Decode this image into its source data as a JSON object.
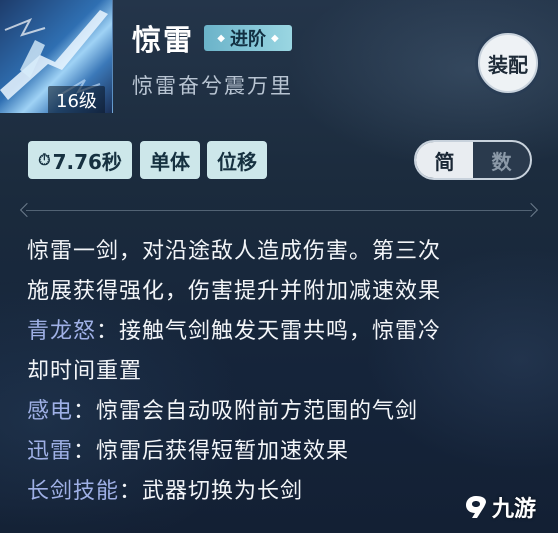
{
  "skill": {
    "name": "惊雷",
    "advance_label": "进阶",
    "subtitle": "惊雷奋兮震万里",
    "level": "16级",
    "equip_label": "装配"
  },
  "tags": {
    "cooldown": "7.76秒",
    "target": "单体",
    "movement": "位移"
  },
  "toggle": {
    "simple": "简",
    "numeric": "数",
    "active": "simple"
  },
  "description": {
    "intro_line1": "惊雷一剑，对沿途敌人造成伤害。第三次",
    "intro_line2": "施展获得强化，伤害提升并附加减速效果",
    "effects": [
      {
        "name": "青龙怒",
        "text_line1": "：接触气剑触发天雷共鸣，惊雷冷",
        "text_line2": "却时间重置"
      },
      {
        "name": "感电",
        "text_line1": "：惊雷会自动吸附前方范围的气剑"
      },
      {
        "name": "迅雷",
        "text_line1": "：惊雷后获得短暂加速效果"
      },
      {
        "name": "长剑技能",
        "text_line1": "：武器切换为长剑"
      }
    ]
  },
  "watermark": {
    "text": "九游"
  },
  "colors": {
    "keyword": "#9fb0e6",
    "tag_bg": "#cde7ea",
    "advance_bg": "#8ccbd9"
  },
  "icons": {
    "skill_icon": "sword-lightning-icon",
    "cooldown": "clock-icon",
    "watermark": "9game-logo-icon"
  }
}
